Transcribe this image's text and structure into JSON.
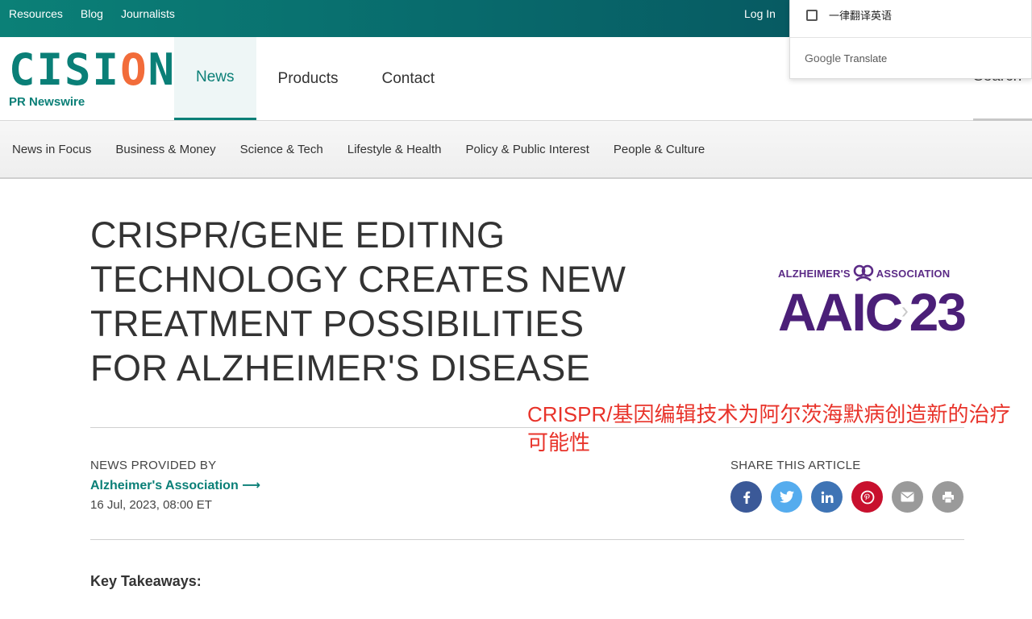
{
  "topbar": {
    "links": [
      "Resources",
      "Blog",
      "Journalists"
    ],
    "login": "Log In"
  },
  "logo": {
    "word_c": "C",
    "word_i": "IS",
    "word_o": "I",
    "word_rest": "ON",
    "subtitle": "PR Newswire"
  },
  "nav": {
    "news": "News",
    "products": "Products",
    "contact": "Contact",
    "search_partial": "Search"
  },
  "categories": [
    "News in Focus",
    "Business & Money",
    "Science & Tech",
    "Lifestyle & Health",
    "Policy & Public Interest",
    "People & Culture"
  ],
  "translate_popup": {
    "checkbox_label": "一律翻译英语",
    "brand_google": "Google",
    "brand_translate": "Translate"
  },
  "article": {
    "headline": "CRISPR/GENE EDITING TECHNOLOGY CREATES NEW TREATMENT POSSIBILITIES FOR ALZHEIMER'S DISEASE",
    "translation": "CRISPR/基因编辑技术为阿尔茨海默病创造新的治疗可能性",
    "provided_label": "NEWS PROVIDED BY",
    "org": "Alzheimer's Association",
    "org_arrow": "⟶",
    "date": "16 Jul, 2023, 08:00 ET",
    "share_label": "SHARE THIS ARTICLE",
    "key_takeaways": "Key Takeaways:"
  },
  "aaic_logo": {
    "top_left": "ALZHEIMER'S",
    "top_right": "ASSOCIATION",
    "main_left": "AAIC",
    "main_right": "23"
  },
  "share_icons": [
    {
      "name": "facebook-icon",
      "glyph": "f",
      "color": "#3b5998"
    },
    {
      "name": "twitter-icon",
      "glyph": "t",
      "color": "#55acee"
    },
    {
      "name": "linkedin-icon",
      "glyph": "in",
      "color": "#3f74b5"
    },
    {
      "name": "pinterest-icon",
      "glyph": "p",
      "color": "#c8102e"
    },
    {
      "name": "email-icon",
      "glyph": "✉",
      "color": "#9a9a9a"
    },
    {
      "name": "print-icon",
      "glyph": "⎙",
      "color": "#9a9a9a"
    }
  ],
  "colors": {
    "brand_teal": "#0a7f77",
    "brand_orange": "#f26c3a",
    "aaic_purple": "#4b1f78",
    "translation_red": "#e8332a"
  }
}
